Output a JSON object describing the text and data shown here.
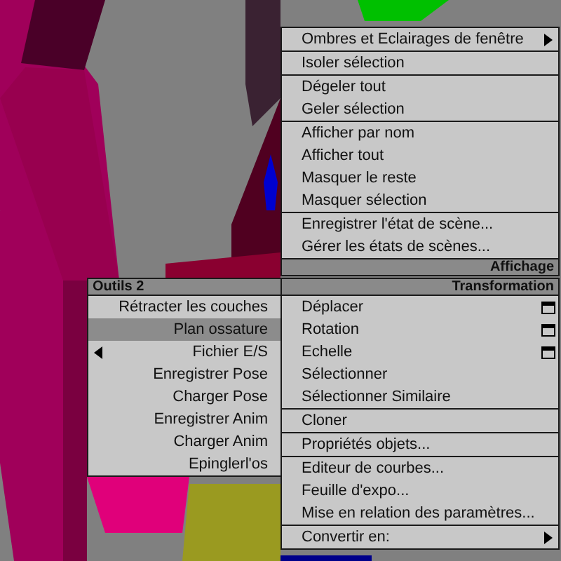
{
  "quad_menus": [
    {
      "title": "Affichage",
      "groups": [
        [
          {
            "label": "Ombres et Eclairages de fenêtre",
            "kind": "submenu",
            "selected": false
          }
        ],
        [
          {
            "label": "Isoler sélection",
            "kind": "plain",
            "selected": false
          }
        ],
        [
          {
            "label": "Dégeler tout",
            "kind": "plain",
            "selected": false
          },
          {
            "label": "Geler sélection",
            "kind": "plain",
            "selected": false
          }
        ],
        [
          {
            "label": "Afficher par nom",
            "kind": "plain",
            "selected": false
          },
          {
            "label": "Afficher tout",
            "kind": "plain",
            "selected": false
          },
          {
            "label": "Masquer le reste",
            "kind": "plain",
            "selected": false
          },
          {
            "label": "Masquer sélection",
            "kind": "plain",
            "selected": false
          }
        ],
        [
          {
            "label": "Enregistrer l'état de scène...",
            "kind": "plain",
            "selected": false
          },
          {
            "label": "Gérer les états de scènes...",
            "kind": "plain",
            "selected": false
          }
        ]
      ]
    },
    {
      "title": "Outils 2",
      "groups": [
        [
          {
            "label": "Rétracter les couches",
            "kind": "plain",
            "selected": false
          },
          {
            "label": "Plan ossature",
            "kind": "plain",
            "selected": true
          },
          {
            "label": "Fichier E/S",
            "kind": "submenu",
            "selected": false
          },
          {
            "label": "Enregistrer Pose",
            "kind": "plain",
            "selected": false
          },
          {
            "label": "Charger Pose",
            "kind": "plain",
            "selected": false
          },
          {
            "label": "Enregistrer Anim",
            "kind": "plain",
            "selected": false
          },
          {
            "label": "Charger Anim",
            "kind": "plain",
            "selected": false
          },
          {
            "label": "Epinglerl'os",
            "kind": "plain",
            "selected": false
          }
        ]
      ]
    },
    {
      "title": "Transformation",
      "groups": [
        [
          {
            "label": "Déplacer",
            "kind": "options",
            "selected": false
          },
          {
            "label": "Rotation",
            "kind": "options",
            "selected": false
          },
          {
            "label": "Echelle",
            "kind": "options",
            "selected": false
          },
          {
            "label": "Sélectionner",
            "kind": "plain",
            "selected": false
          },
          {
            "label": "Sélectionner Similaire",
            "kind": "plain",
            "selected": false
          }
        ],
        [
          {
            "label": "Cloner",
            "kind": "plain",
            "selected": false
          }
        ],
        [
          {
            "label": "Propriétés objets...",
            "kind": "plain",
            "selected": false
          }
        ],
        [
          {
            "label": "Editeur de courbes...",
            "kind": "plain",
            "selected": false
          },
          {
            "label": "Feuille d'expo...",
            "kind": "plain",
            "selected": false
          },
          {
            "label": "Mise en relation des paramètres...",
            "kind": "plain",
            "selected": false
          }
        ],
        [
          {
            "label": "Convertir en:",
            "kind": "submenu",
            "selected": false
          }
        ]
      ]
    }
  ]
}
